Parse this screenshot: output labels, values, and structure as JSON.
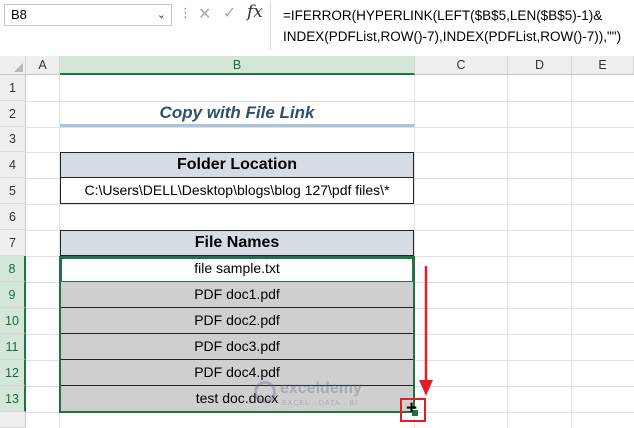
{
  "formula_bar": {
    "name_box": "B8",
    "formula_line1": "=IFERROR(HYPERLINK(LEFT($B$5,LEN($B$5)-1)&",
    "formula_line2": "INDEX(PDFList,ROW()-7),INDEX(PDFList,ROW()-7)),\"\")",
    "cancel_glyph": "✕",
    "enter_glyph": "✓",
    "fx_glyph": "fx"
  },
  "columns": [
    "A",
    "B",
    "C",
    "D",
    "E"
  ],
  "rows": [
    "1",
    "2",
    "3",
    "4",
    "5",
    "6",
    "7",
    "8",
    "9",
    "10",
    "11",
    "12",
    "13"
  ],
  "selected_cell": "B8",
  "title": "Copy with File Link",
  "folder_table": {
    "header": "Folder Location",
    "value": "C:\\Users\\DELL\\Desktop\\blogs\\blog 127\\pdf files\\*"
  },
  "file_table": {
    "header": "File Names",
    "rows": [
      "file sample.txt",
      "PDF doc1.pdf",
      "PDF doc2.pdf",
      "PDF doc3.pdf",
      "PDF doc4.pdf",
      "test doc.docx"
    ]
  },
  "watermark": {
    "name": "exceldemy",
    "tagline": "EXCEL · DATA · BI"
  },
  "colors": {
    "accent": "#217346",
    "title": "#2f4e72",
    "header_fill": "#d6dce4",
    "row_fill": "#cfcfcf",
    "annotation": "#e41c23"
  }
}
